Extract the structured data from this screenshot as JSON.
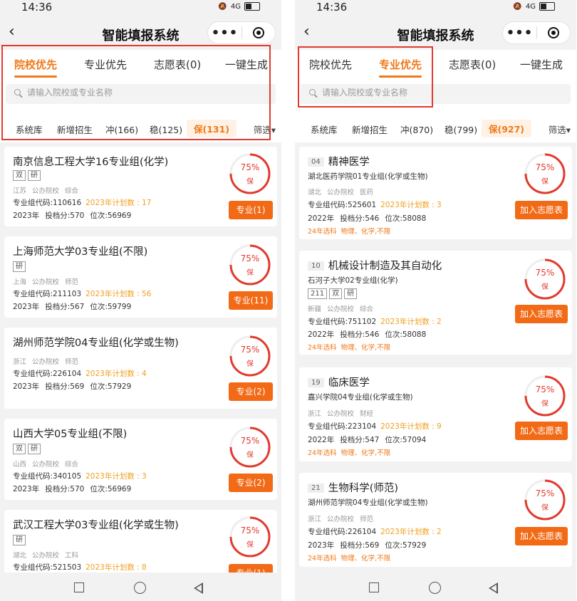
{
  "status": {
    "time": "14:36",
    "signal": "4G"
  },
  "app": {
    "title": "智能填报系统",
    "more": "•••"
  },
  "search_placeholder": "请输入院校或专业名称",
  "left": {
    "tabs": [
      "院校优先",
      "专业优先",
      "志愿表(0)",
      "一键生成"
    ],
    "filters": [
      "系统库",
      "新增招生",
      "冲(166)",
      "稳(125)",
      "保(131)"
    ],
    "filter_more": "筛选▾",
    "cards": [
      {
        "title": "南京信息工程大学16专业组(化学)",
        "badges": [
          "双",
          "研"
        ],
        "meta": [
          "江苏",
          "公办院校",
          "综合"
        ],
        "code": "专业组代码:110616",
        "plan": "2023年计划数 : 17",
        "year": "2023年",
        "score": "投档分:570",
        "rank": "位次:56969",
        "pct": "75%",
        "plabel": "保",
        "btn": "专业(1)"
      },
      {
        "title": "上海师范大学03专业组(不限)",
        "badges": [
          "研"
        ],
        "meta": [
          "上海",
          "公办院校",
          "师范"
        ],
        "code": "专业组代码:211103",
        "plan": "2023年计划数 : 56",
        "year": "2023年",
        "score": "投档分:567",
        "rank": "位次:59799",
        "pct": "75%",
        "plabel": "保",
        "btn": "专业(11)"
      },
      {
        "title": "湖州师范学院04专业组(化学或生物)",
        "badges": [],
        "meta": [
          "浙江",
          "公办院校",
          "师范"
        ],
        "code": "专业组代码:226104",
        "plan": "2023年计划数 : 4",
        "year": "2023年",
        "score": "投档分:569",
        "rank": "位次:57929",
        "pct": "75%",
        "plabel": "保",
        "btn": "专业(2)"
      },
      {
        "title": "山西大学05专业组(不限)",
        "badges": [
          "双",
          "研"
        ],
        "meta": [
          "山西",
          "公办院校",
          "综合"
        ],
        "code": "专业组代码:340105",
        "plan": "2023年计划数 : 3",
        "year": "2023年",
        "score": "投档分:570",
        "rank": "位次:56969",
        "pct": "75%",
        "plabel": "保",
        "btn": "专业(2)"
      },
      {
        "title": "武汉工程大学03专业组(化学或生物)",
        "badges": [
          "研"
        ],
        "meta": [
          "湖北",
          "公办院校",
          "工科"
        ],
        "code": "专业组代码:521503",
        "plan": "2023年计划数 : 8",
        "year": "",
        "score": "",
        "rank": "",
        "pct": "75%",
        "plabel": "保",
        "btn": "专业(1)"
      }
    ]
  },
  "right": {
    "tabs": [
      "院校优先",
      "专业优先",
      "志愿表(0)",
      "一键生成"
    ],
    "filters": [
      "系统库",
      "新增招生",
      "冲(870)",
      "稳(799)",
      "保(927)"
    ],
    "filter_more": "筛选▾",
    "cards": [
      {
        "rank": "04",
        "title": "精神医学",
        "sub": "湖北医药学院01专业组(化学或生物)",
        "badges": [],
        "meta": [
          "湖北",
          "公办院校",
          "医药"
        ],
        "code": "专业组代码:525601",
        "plan": "2023年计划数 : 3",
        "year": "2022年",
        "score": "投档分:546",
        "rank2": "位次:58088",
        "req": [
          "24年选科",
          "物理、化学,不限"
        ],
        "pct": "75%",
        "plabel": "保",
        "btn": "加入志愿表"
      },
      {
        "rank": "10",
        "title": "机械设计制造及其自动化",
        "sub": "石河子大学02专业组(化学)",
        "badges": [
          "211",
          "双",
          "研"
        ],
        "meta": [
          "新疆",
          "公办院校",
          "综合"
        ],
        "code": "专业组代码:751102",
        "plan": "2023年计划数 : 2",
        "year": "2022年",
        "score": "投档分:546",
        "rank2": "位次:58088",
        "req": [
          "24年选科",
          "物理、化学,不限"
        ],
        "pct": "75%",
        "plabel": "保",
        "btn": "加入志愿表"
      },
      {
        "rank": "19",
        "title": "临床医学",
        "sub": "嘉兴学院04专业组(化学或生物)",
        "badges": [],
        "meta": [
          "浙江",
          "公办院校",
          "财经"
        ],
        "code": "专业组代码:223104",
        "plan": "2023年计划数 : 9",
        "year": "2022年",
        "score": "投档分:547",
        "rank2": "位次:57094",
        "req": [
          "24年选科",
          "物理、化学,不限"
        ],
        "pct": "75%",
        "plabel": "保",
        "btn": "加入志愿表"
      },
      {
        "rank": "21",
        "title": "生物科学(师范)",
        "sub": "湖州师范学院04专业组(化学或生物)",
        "badges": [],
        "meta": [
          "浙江",
          "公办院校",
          "师范"
        ],
        "code": "专业组代码:226104",
        "plan": "2023年计划数 : 2",
        "year": "2023年",
        "score": "投档分:569",
        "rank2": "位次:57929",
        "req": [
          "24年选科",
          "物理、化学,不限"
        ],
        "pct": "75%",
        "plabel": "保",
        "btn": "加入志愿表"
      }
    ]
  }
}
